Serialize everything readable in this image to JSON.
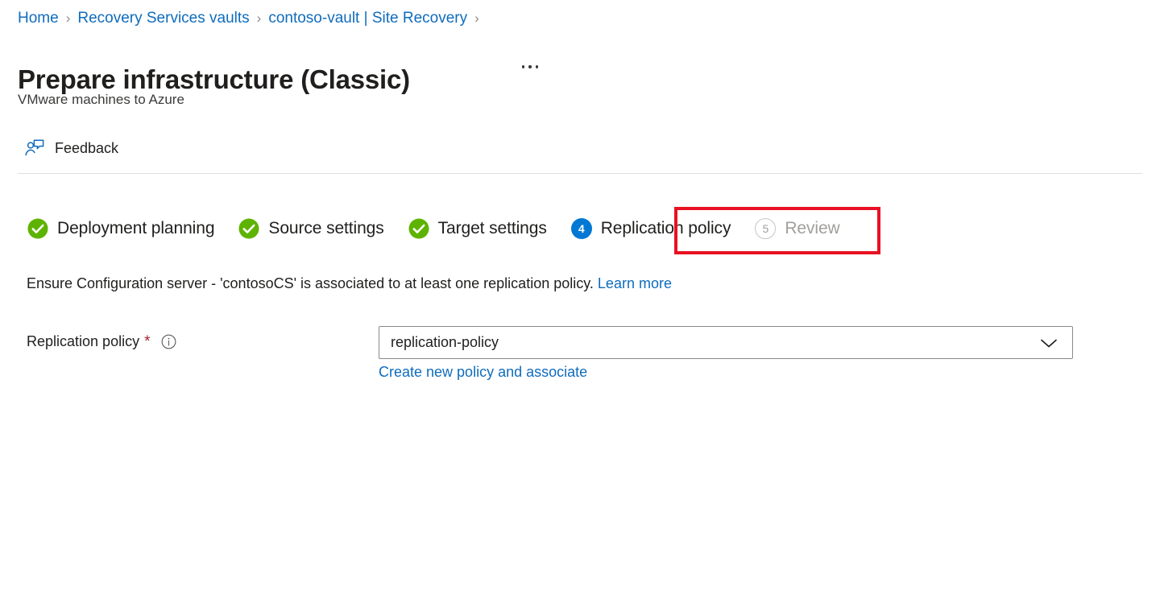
{
  "breadcrumb": {
    "separator": "›",
    "items": [
      {
        "label": "Home"
      },
      {
        "label": "Recovery Services vaults"
      },
      {
        "label": "contoso-vault | Site Recovery"
      }
    ],
    "trailing_separator": "›"
  },
  "header": {
    "title": "Prepare infrastructure (Classic)",
    "subtitle": "VMware machines to Azure",
    "more_menu_icon": "ellipsis-icon"
  },
  "commandbar": {
    "feedback_label": "Feedback",
    "feedback_icon": "feedback-person-icon"
  },
  "wizard": {
    "steps": [
      {
        "number": "1",
        "label": "Deployment planning",
        "state": "completed",
        "icon": "check-circle-icon"
      },
      {
        "number": "2",
        "label": "Source settings",
        "state": "completed",
        "icon": "check-circle-icon"
      },
      {
        "number": "3",
        "label": "Target settings",
        "state": "completed",
        "icon": "check-circle-icon"
      },
      {
        "number": "4",
        "label": "Replication policy",
        "state": "active",
        "icon": "number-circle-icon"
      },
      {
        "number": "5",
        "label": "Review",
        "state": "disabled",
        "icon": "number-circle-icon"
      }
    ],
    "highlight_step": "Replication policy"
  },
  "content": {
    "description_text": "Ensure Configuration server - 'contosoCS' is associated to at least one replication policy.",
    "learn_more_label": "Learn more",
    "field": {
      "label": "Replication policy",
      "required_marker": "*",
      "info_icon": "info-circle-icon",
      "dropdown_value": "replication-policy",
      "dropdown_icon": "chevron-down-icon",
      "create_link_label": "Create new policy and associate"
    }
  },
  "colors": {
    "link": "#0f6cbd",
    "completed_step": "#5db300",
    "active_step": "#0078d4",
    "disabled_step": "#a19f9d",
    "required_asterisk": "#a4262c",
    "highlight_border": "#e81123"
  }
}
